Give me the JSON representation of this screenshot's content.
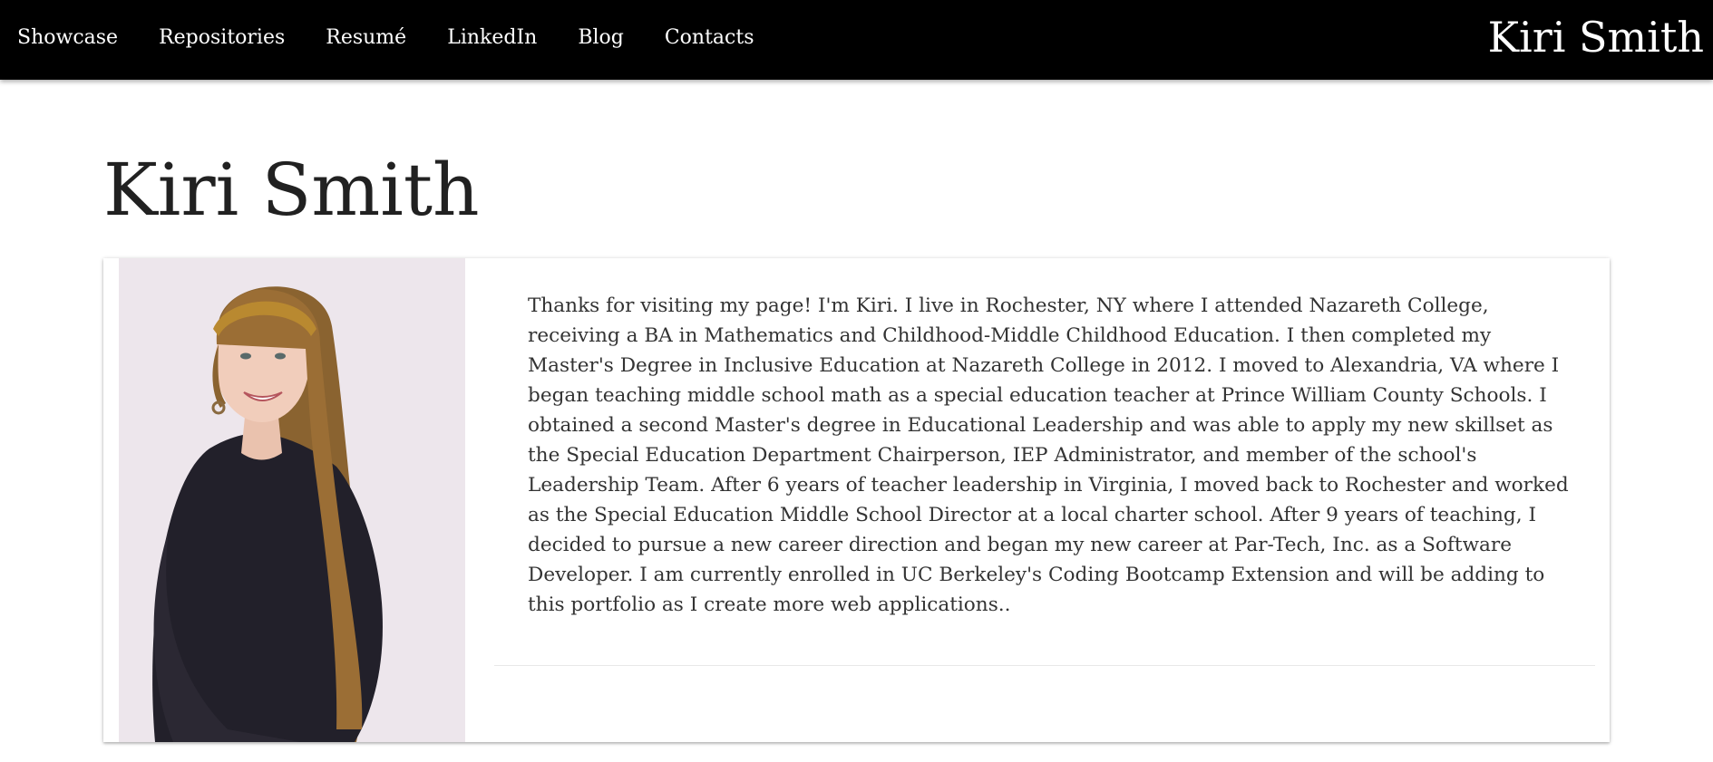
{
  "nav": {
    "links": [
      "Showcase",
      "Repositories",
      "Resumé",
      "LinkedIn",
      "Blog",
      "Contacts"
    ],
    "brand": "Kiri Smith"
  },
  "main": {
    "title": "Kiri Smith",
    "bio": "Thanks for visiting my page! I'm Kiri. I live in Rochester, NY where I attended Nazareth College, receiving a BA in Mathematics and Childhood-Middle Childhood Education. I then completed my Master's Degree in Inclusive Education at Nazareth College in 2012. I moved to Alexandria, VA where I began teaching middle school math as a special education teacher at Prince William County Schools. I obtained a second Master's degree in Educational Leadership and was able to apply my new skillset as the Special Education Department Chairperson, IEP Administrator, and member of the school's Leadership Team. After 6 years of teacher leadership in Virginia, I moved back to Rochester and worked as the Special Education Middle School Director at a local charter school. After 9 years of teaching, I decided to pursue a new career direction and began my new career at Par-Tech, Inc. as a Software Developer. I am currently enrolled in UC Berkeley's Coding Bootcamp Extension and will be adding to this portfolio as I create more web applications.."
  },
  "colors": {
    "nav_background": "#000000",
    "nav_text": "#ffffff",
    "page_background": "#ffffff",
    "title_text": "#212121",
    "body_text": "#333333",
    "photo_background": "#ede6ec"
  }
}
